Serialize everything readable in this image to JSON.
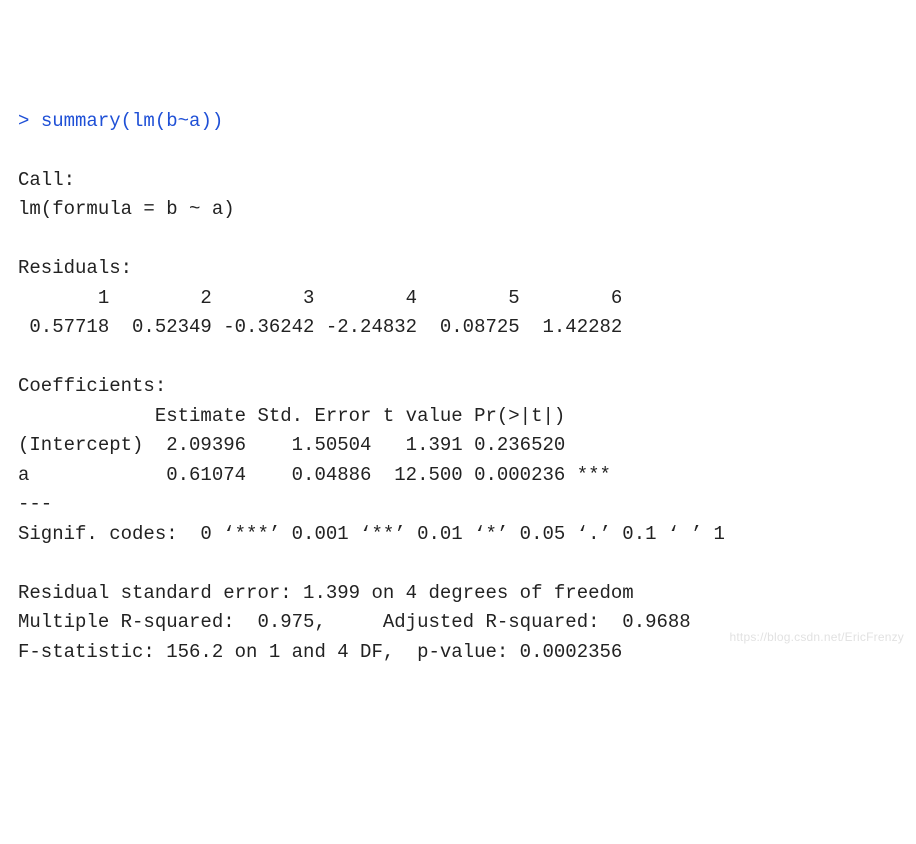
{
  "prompt": "> ",
  "command": "summary(lm(b~a))",
  "blank": "",
  "call_header": "Call:",
  "call_line": "lm(formula = b ~ a)",
  "residuals_header": "Residuals:",
  "residuals_idx": "       1        2        3        4        5        6 ",
  "residuals_vals": " 0.57718  0.52349 -0.36242 -2.24832  0.08725  1.42282 ",
  "coef_header": "Coefficients:",
  "coef_cols": "            Estimate Std. Error t value Pr(>|t|)    ",
  "coef_intercept": "(Intercept)  2.09396    1.50504   1.391 0.236520    ",
  "coef_a": "a            0.61074    0.04886  12.500 0.000236 ***",
  "dashes": "---",
  "signif": "Signif. codes:  0 ‘***’ 0.001 ‘**’ 0.01 ‘*’ 0.05 ‘.’ 0.1 ‘ ’ 1",
  "rse": "Residual standard error: 1.399 on 4 degrees of freedom",
  "rsq": "Multiple R-squared:  0.975,\tAdjusted R-squared:  0.9688 ",
  "fstat": "F-statistic: 156.2 on 1 and 4 DF,  p-value: 0.0002356",
  "watermark": "https://blog.csdn.net/EricFrenzy",
  "chart_data": {
    "type": "table",
    "title": "summary(lm(b~a))",
    "coefficients": {
      "columns": [
        "term",
        "Estimate",
        "Std. Error",
        "t value",
        "Pr(>|t|)",
        "signif"
      ],
      "rows": [
        [
          "(Intercept)",
          2.09396,
          1.50504,
          1.391,
          0.23652,
          ""
        ],
        [
          "a",
          0.61074,
          0.04886,
          12.5,
          0.000236,
          "***"
        ]
      ]
    },
    "residuals": {
      "index": [
        1,
        2,
        3,
        4,
        5,
        6
      ],
      "values": [
        0.57718,
        0.52349,
        -0.36242,
        -2.24832,
        0.08725,
        1.42282
      ]
    },
    "residual_standard_error": 1.399,
    "df_residual": 4,
    "multiple_r_squared": 0.975,
    "adjusted_r_squared": 0.9688,
    "f_statistic": 156.2,
    "f_df": [
      1,
      4
    ],
    "p_value": 0.0002356
  }
}
